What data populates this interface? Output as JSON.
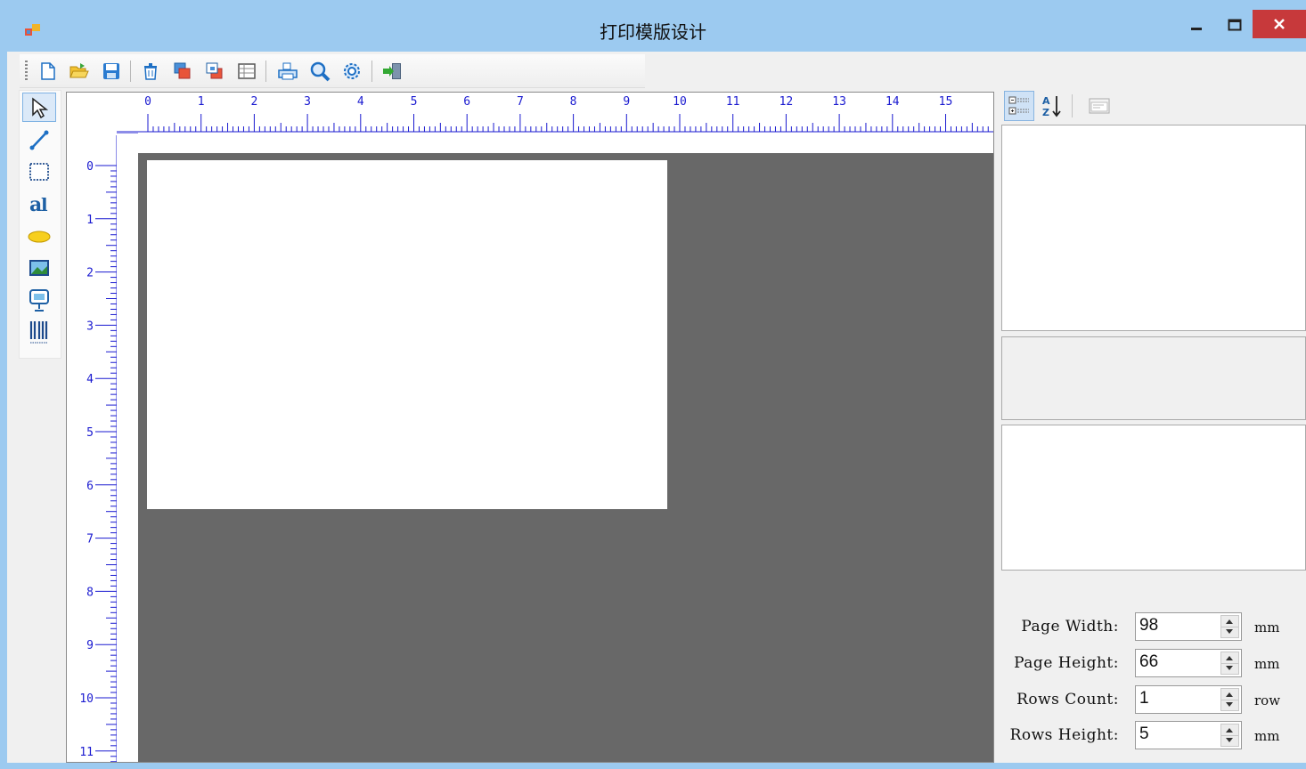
{
  "window": {
    "title": "打印模版设计"
  },
  "toolbar": {
    "buttons": [
      "new-icon",
      "open-icon",
      "save-icon",
      "delete-icon",
      "bring-front-icon",
      "send-back-icon",
      "table-icon",
      "print-icon",
      "preview-icon",
      "settings-icon",
      "exit-icon"
    ]
  },
  "tools": [
    "pointer-icon",
    "line-icon",
    "rectangle-icon",
    "text-icon",
    "ellipse-icon",
    "image-icon",
    "shape-icon",
    "barcode-icon"
  ],
  "ruler": {
    "h_labels": [
      "0",
      "1",
      "2",
      "3",
      "4",
      "5",
      "6",
      "7",
      "8",
      "9",
      "10",
      "11",
      "12",
      "13",
      "14",
      "15"
    ],
    "v_labels": [
      "0",
      "1",
      "2",
      "3",
      "4",
      "5",
      "6",
      "7",
      "8",
      "9",
      "10",
      "11"
    ]
  },
  "fields": [
    {
      "label": "Page Width:",
      "value": "98",
      "unit": "mm"
    },
    {
      "label": "Page Height:",
      "value": "66",
      "unit": "mm"
    },
    {
      "label": "Rows Count:",
      "value": "1",
      "unit": "row"
    },
    {
      "label": "Rows Height:",
      "value": "5",
      "unit": "mm"
    }
  ],
  "colors": {
    "title_bar": "#9ccaf0",
    "close": "#c7393b",
    "canvas": "#686868",
    "ruler": "#1a1ad0"
  }
}
